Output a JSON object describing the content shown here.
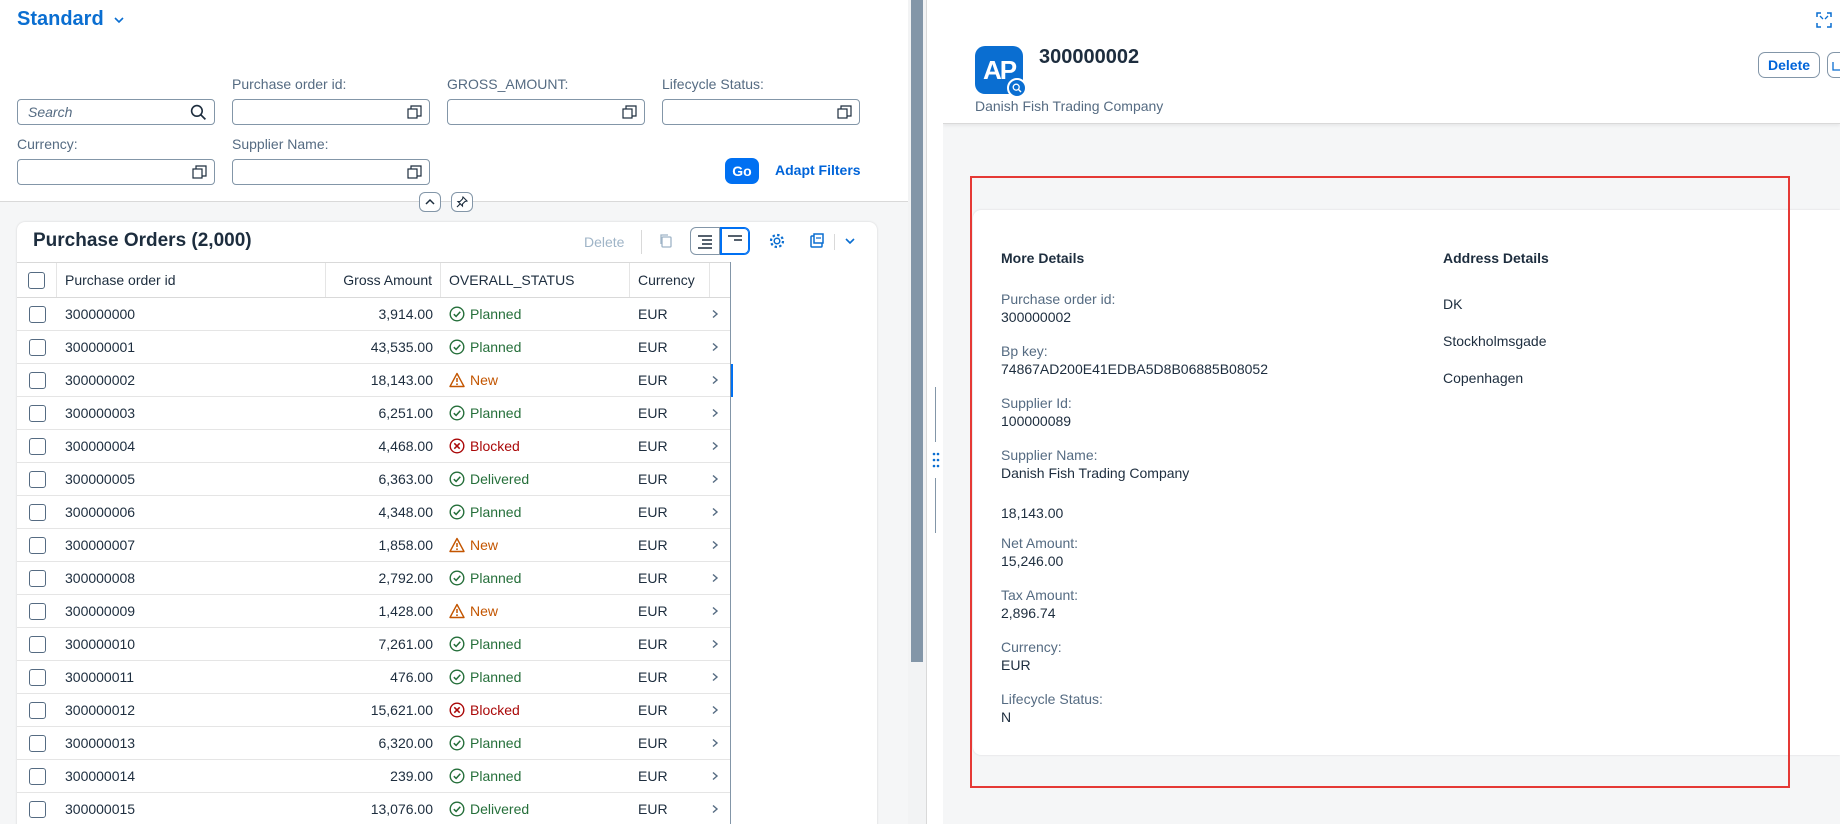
{
  "filterbar": {
    "variant_title": "Standard",
    "search_placeholder": "Search",
    "fields": {
      "po_id_label": "Purchase order id:",
      "gross_label": "GROSS_AMOUNT:",
      "lifecycle_label": "Lifecycle Status:",
      "currency_label": "Currency:",
      "supplier_label": "Supplier Name:"
    },
    "go_label": "Go",
    "adapt_label": "Adapt Filters"
  },
  "table": {
    "title": "Purchase Orders (2,000)",
    "delete_label": "Delete",
    "columns": [
      "Purchase order id",
      "Gross Amount",
      "OVERALL_STATUS",
      "Currency"
    ],
    "rows": [
      {
        "id": "300000000",
        "amount": "3,914.00",
        "status": "Planned",
        "kind": "success",
        "currency": "EUR"
      },
      {
        "id": "300000001",
        "amount": "43,535.00",
        "status": "Planned",
        "kind": "success",
        "currency": "EUR"
      },
      {
        "id": "300000002",
        "amount": "18,143.00",
        "status": "New",
        "kind": "warning",
        "currency": "EUR",
        "selected": true
      },
      {
        "id": "300000003",
        "amount": "6,251.00",
        "status": "Planned",
        "kind": "success",
        "currency": "EUR"
      },
      {
        "id": "300000004",
        "amount": "4,468.00",
        "status": "Blocked",
        "kind": "error",
        "currency": "EUR"
      },
      {
        "id": "300000005",
        "amount": "6,363.00",
        "status": "Delivered",
        "kind": "success",
        "currency": "EUR"
      },
      {
        "id": "300000006",
        "amount": "4,348.00",
        "status": "Planned",
        "kind": "success",
        "currency": "EUR"
      },
      {
        "id": "300000007",
        "amount": "1,858.00",
        "status": "New",
        "kind": "warning",
        "currency": "EUR"
      },
      {
        "id": "300000008",
        "amount": "2,792.00",
        "status": "Planned",
        "kind": "success",
        "currency": "EUR"
      },
      {
        "id": "300000009",
        "amount": "1,428.00",
        "status": "New",
        "kind": "warning",
        "currency": "EUR"
      },
      {
        "id": "300000010",
        "amount": "7,261.00",
        "status": "Planned",
        "kind": "success",
        "currency": "EUR"
      },
      {
        "id": "300000011",
        "amount": "476.00",
        "status": "Planned",
        "kind": "success",
        "currency": "EUR"
      },
      {
        "id": "300000012",
        "amount": "15,621.00",
        "status": "Blocked",
        "kind": "error",
        "currency": "EUR"
      },
      {
        "id": "300000013",
        "amount": "6,320.00",
        "status": "Planned",
        "kind": "success",
        "currency": "EUR"
      },
      {
        "id": "300000014",
        "amount": "239.00",
        "status": "Planned",
        "kind": "success",
        "currency": "EUR"
      },
      {
        "id": "300000015",
        "amount": "13,076.00",
        "status": "Delivered",
        "kind": "success",
        "currency": "EUR"
      }
    ]
  },
  "detail": {
    "avatar_initials": "AP",
    "title": "300000002",
    "subtitle": "Danish Fish Trading Company",
    "delete_label": "Delete",
    "more_details_title": "More Details",
    "address_details_title": "Address Details",
    "fields": [
      {
        "label": "Purchase order id:",
        "value": "300000002"
      },
      {
        "label": "Bp key:",
        "value": "74867AD200E41EDBA5D8B06885B08052"
      },
      {
        "label": "Supplier Id:",
        "value": "100000089"
      },
      {
        "label": "Supplier Name:",
        "value": "Danish Fish Trading Company"
      },
      {
        "label": "",
        "value": "18,143.00"
      },
      {
        "label": "Net Amount:",
        "value": "15,246.00"
      },
      {
        "label": "Tax Amount:",
        "value": "2,896.74"
      },
      {
        "label": "Currency:",
        "value": "EUR"
      },
      {
        "label": "Lifecycle Status:",
        "value": "N"
      }
    ],
    "address": [
      "DK",
      "Stockholmsgade",
      "Copenhagen"
    ]
  },
  "colors": {
    "brand": "#0a6ed1",
    "success": "#256f3a",
    "warning": "#c35500",
    "error": "#aa0808",
    "highlight": "#e53935"
  }
}
